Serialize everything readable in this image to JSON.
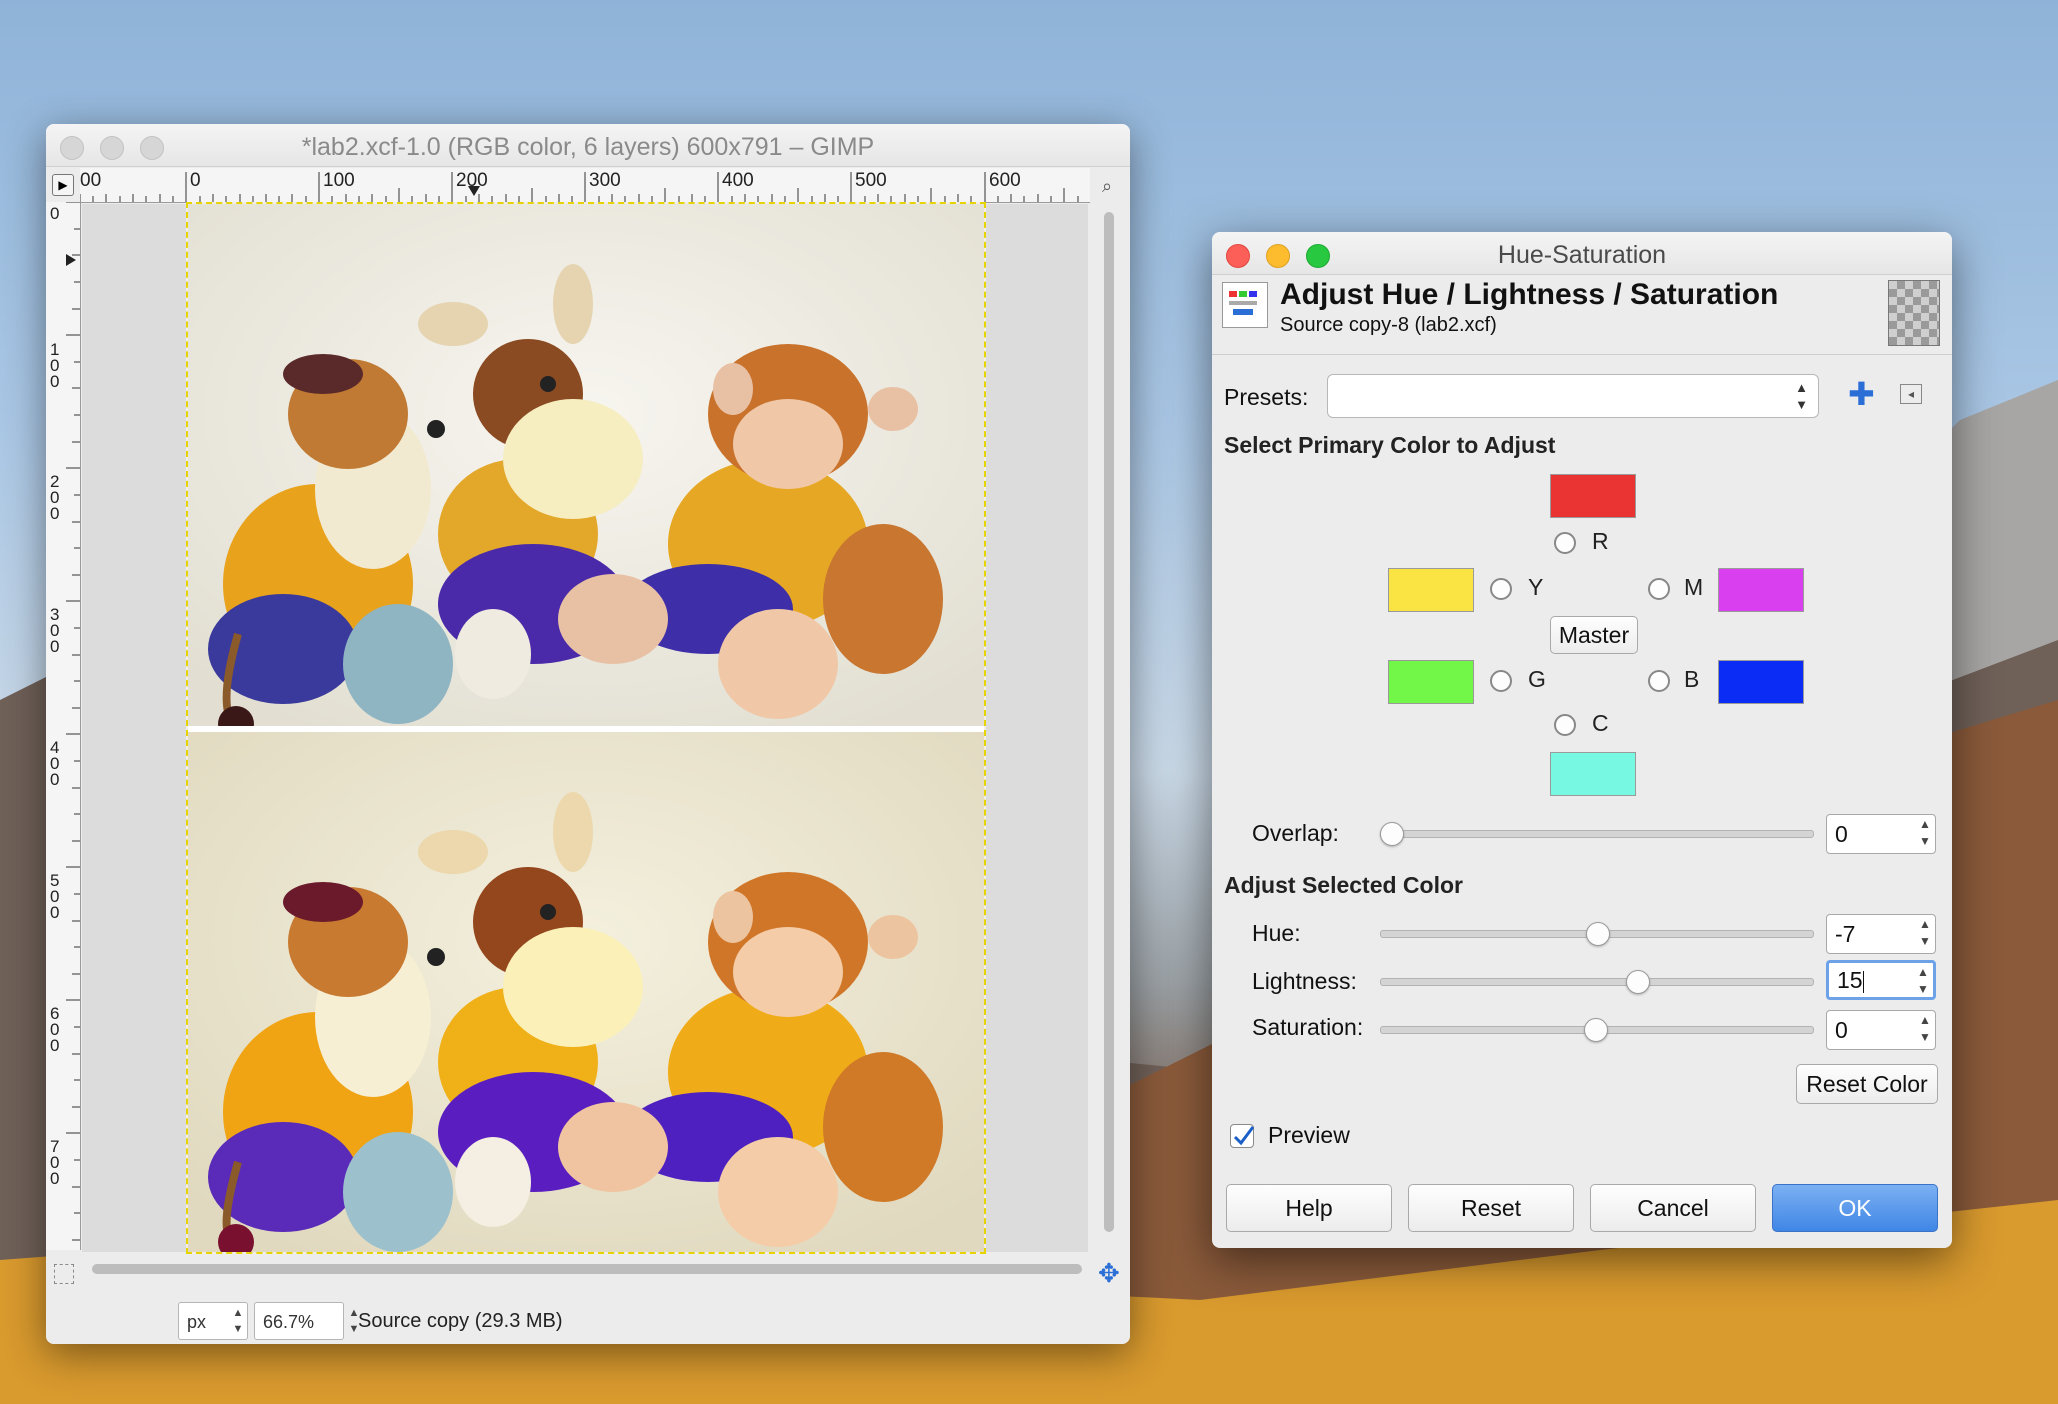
{
  "gimp_window": {
    "title": "*lab2.xcf-1.0 (RGB color, 6 layers) 600x791 – GIMP",
    "ruler_h_labels": [
      "00",
      "0",
      "100",
      "200",
      "300",
      "400",
      "500",
      "600"
    ],
    "ruler_v_labels": [
      "0",
      "1\n0\n0",
      "2\n0\n0",
      "3\n0\n0",
      "4\n0\n0",
      "5\n0\n0",
      "6\n0\n0",
      "7\n0\n0"
    ],
    "status": {
      "unit": "px",
      "zoom": "66.7%",
      "layer_info": "Source copy (29.3 MB)"
    }
  },
  "dialog": {
    "title": "Hue-Saturation",
    "header_title": "Adjust Hue / Lightness / Saturation",
    "header_subtitle": "Source copy-8 (lab2.xcf)",
    "presets_label": "Presets:",
    "presets_value": "",
    "primary_section": "Select Primary Color to Adjust",
    "colors": {
      "R": {
        "label": "R",
        "hex": "#ea3434"
      },
      "Y": {
        "label": "Y",
        "hex": "#fae443"
      },
      "M": {
        "label": "M",
        "hex": "#d93fef"
      },
      "G": {
        "label": "G",
        "hex": "#72f648"
      },
      "B": {
        "label": "B",
        "hex": "#0a2cf5"
      },
      "C": {
        "label": "C",
        "hex": "#76f8e2"
      }
    },
    "master_label": "Master",
    "overlap_label": "Overlap:",
    "overlap_value": "0",
    "adjust_section": "Adjust Selected Color",
    "hue_label": "Hue:",
    "hue_value": "-7",
    "lightness_label": "Lightness:",
    "lightness_value": "15",
    "saturation_label": "Saturation:",
    "saturation_value": "0",
    "reset_color_label": "Reset Color",
    "preview_label": "Preview",
    "preview_checked": true,
    "buttons": {
      "help": "Help",
      "reset": "Reset",
      "cancel": "Cancel",
      "ok": "OK"
    }
  }
}
